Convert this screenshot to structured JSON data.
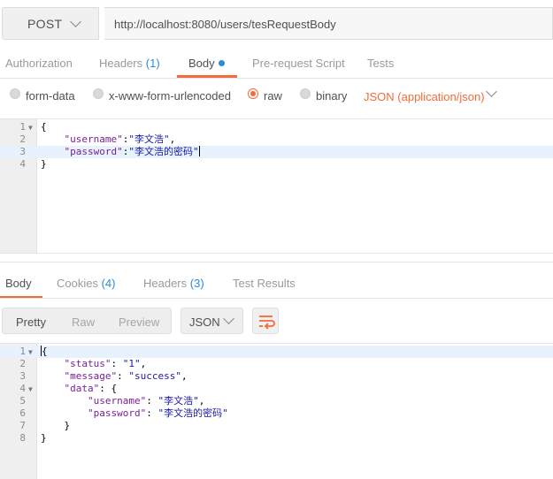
{
  "request": {
    "method": "POST",
    "url": "http://localhost:8080/users/tesRequestBody"
  },
  "request_tabs": [
    {
      "label": "Authorization"
    },
    {
      "label": "Headers",
      "count": "(1)"
    },
    {
      "label": "Body",
      "active": true
    },
    {
      "label": "Pre-request Script"
    },
    {
      "label": "Tests"
    }
  ],
  "body_types": [
    {
      "label": "form-data",
      "selected": false
    },
    {
      "label": "x-www-form-urlencoded",
      "selected": false
    },
    {
      "label": "raw",
      "selected": true
    },
    {
      "label": "binary",
      "selected": false
    }
  ],
  "raw_format": "JSON (application/json)",
  "request_body": {
    "lines": [
      {
        "num": "1",
        "fold": true,
        "text": "{"
      },
      {
        "num": "2",
        "indent": "    ",
        "key": "\"username\"",
        "sep": ":",
        "value": "\"李文浩\"",
        "end": ","
      },
      {
        "num": "3",
        "indent": "    ",
        "key": "\"password\"",
        "sep": ":",
        "value": "\"李文浩的密码\"",
        "end": "",
        "highlight": true,
        "cursor": true
      },
      {
        "num": "4",
        "text": "}"
      }
    ]
  },
  "response_tabs": [
    {
      "label": "Body",
      "active": true
    },
    {
      "label": "Cookies",
      "count": "(4)"
    },
    {
      "label": "Headers",
      "count": "(3)"
    },
    {
      "label": "Test Results"
    }
  ],
  "response_toolbar": {
    "views": [
      "Pretty",
      "Raw",
      "Preview"
    ],
    "active_view": "Pretty",
    "format": "JSON",
    "wrap_icon": "wrap-lines-icon",
    "accent": "#f26b3a"
  },
  "response_body": {
    "lines": [
      {
        "num": "1",
        "fold": true,
        "text": "{",
        "highlight": true
      },
      {
        "num": "2",
        "indent": "    ",
        "key": "\"status\"",
        "sep": ": ",
        "value": "\"1\"",
        "end": ","
      },
      {
        "num": "3",
        "indent": "    ",
        "key": "\"message\"",
        "sep": ": ",
        "value": "\"success\"",
        "end": ","
      },
      {
        "num": "4",
        "fold": true,
        "indent": "    ",
        "key": "\"data\"",
        "sep": ": ",
        "value": "",
        "end": "{"
      },
      {
        "num": "5",
        "indent": "        ",
        "key": "\"username\"",
        "sep": ": ",
        "value": "\"李文浩\"",
        "end": ","
      },
      {
        "num": "6",
        "indent": "        ",
        "key": "\"password\"",
        "sep": ": ",
        "value": "\"李文浩的密码\"",
        "end": ""
      },
      {
        "num": "7",
        "text": "    }"
      },
      {
        "num": "8",
        "text": "}"
      }
    ]
  }
}
